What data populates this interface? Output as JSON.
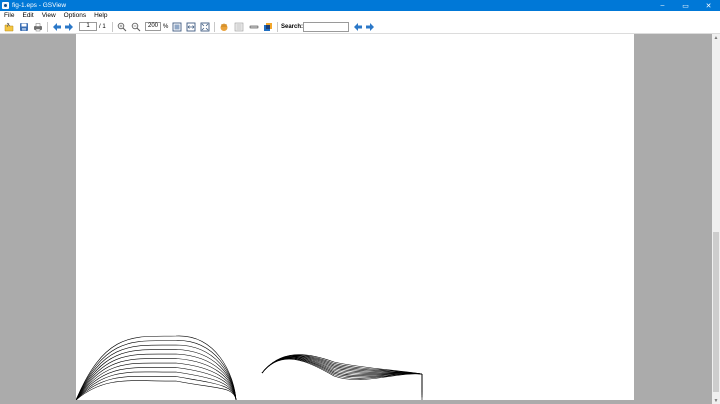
{
  "window": {
    "title": "fig-1.eps - GSView",
    "minimize": "–",
    "maximize": "▭",
    "close": "✕"
  },
  "menu": {
    "items": [
      "File",
      "Edit",
      "View",
      "Options",
      "Help"
    ]
  },
  "toolbar": {
    "page_current": "1",
    "page_total": "/ 1",
    "zoom_value": "200",
    "zoom_unit": "%",
    "search_label": "Search:",
    "search_value": "",
    "icons": [
      "open-icon",
      "save-icon",
      "print-icon",
      "back-arrow-icon",
      "forward-arrow-icon",
      "zoom-in-icon",
      "zoom-out-icon",
      "fit-page-icon",
      "fit-width-icon",
      "full-screen-icon",
      "pan-hand-icon",
      "thumbnails-icon",
      "info-icon",
      "multi-page-icon",
      "search-previous-icon",
      "search-next-icon"
    ],
    "accent": "#2b78c8"
  },
  "document": {
    "file": "fig-1.eps"
  },
  "scrollbar": {
    "up": "▲",
    "down": "▼"
  }
}
